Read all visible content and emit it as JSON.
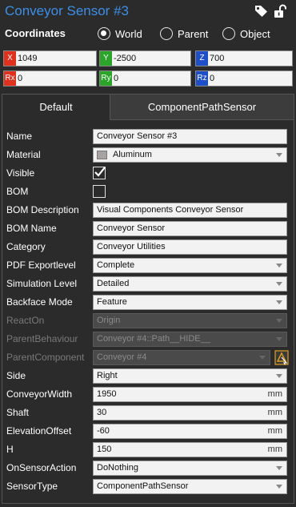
{
  "header": {
    "title": "Conveyor Sensor #3",
    "tag_icon": "tag-icon",
    "lock_icon": "unlock-icon",
    "accent_color": "#3d8ee6"
  },
  "coordinates": {
    "label": "Coordinates",
    "options": [
      {
        "label": "World",
        "selected": true
      },
      {
        "label": "Parent",
        "selected": false
      },
      {
        "label": "Object",
        "selected": false
      }
    ]
  },
  "transform": {
    "x": {
      "badge": "X",
      "value": "1049",
      "color": "#e0301e"
    },
    "y": {
      "badge": "Y",
      "value": "-2500",
      "color": "#2aa52a"
    },
    "z": {
      "badge": "Z",
      "value": "700",
      "color": "#1e4fc8"
    },
    "rx": {
      "badge": "Rx",
      "value": "0",
      "color": "#e0301e"
    },
    "ry": {
      "badge": "Ry",
      "value": "0",
      "color": "#2aa52a"
    },
    "rz": {
      "badge": "Rz",
      "value": "0",
      "color": "#1e4fc8"
    }
  },
  "tabs": [
    {
      "label": "Default",
      "active": true
    },
    {
      "label": "ComponentPathSensor",
      "active": false
    }
  ],
  "properties": {
    "name": {
      "label": "Name",
      "value": "Conveyor Sensor #3"
    },
    "material": {
      "label": "Material",
      "value": "Aluminum",
      "swatch": "#a8a2a0"
    },
    "visible": {
      "label": "Visible",
      "checked": true
    },
    "bom": {
      "label": "BOM",
      "checked": false
    },
    "bom_description": {
      "label": "BOM Description",
      "value": "Visual Components Conveyor Sensor"
    },
    "bom_name": {
      "label": "BOM Name",
      "value": "Conveyor Sensor"
    },
    "category": {
      "label": "Category",
      "value": "Conveyor Utilities"
    },
    "pdf_exportlevel": {
      "label": "PDF Exportlevel",
      "value": "Complete"
    },
    "simulation_level": {
      "label": "Simulation Level",
      "value": "Detailed"
    },
    "backface_mode": {
      "label": "Backface Mode",
      "value": "Feature"
    },
    "react_on": {
      "label": "ReactOn",
      "value": "Origin"
    },
    "parent_behaviour": {
      "label": "ParentBehaviour",
      "value": "Conveyor #4::Path__HIDE__"
    },
    "parent_component": {
      "label": "ParentComponent",
      "value": "Conveyor #4"
    },
    "side": {
      "label": "Side",
      "value": "Right"
    },
    "conveyor_width": {
      "label": "ConveyorWidth",
      "value": "1950",
      "unit": "mm"
    },
    "shaft": {
      "label": "Shaft",
      "value": "30",
      "unit": "mm"
    },
    "elevation_offset": {
      "label": "ElevationOffset",
      "value": "-60",
      "unit": "mm"
    },
    "h": {
      "label": "H",
      "value": "150",
      "unit": "mm"
    },
    "on_sensor_action": {
      "label": "OnSensorAction",
      "value": "DoNothing"
    },
    "sensor_type": {
      "label": "SensorType",
      "value": "ComponentPathSensor"
    }
  }
}
